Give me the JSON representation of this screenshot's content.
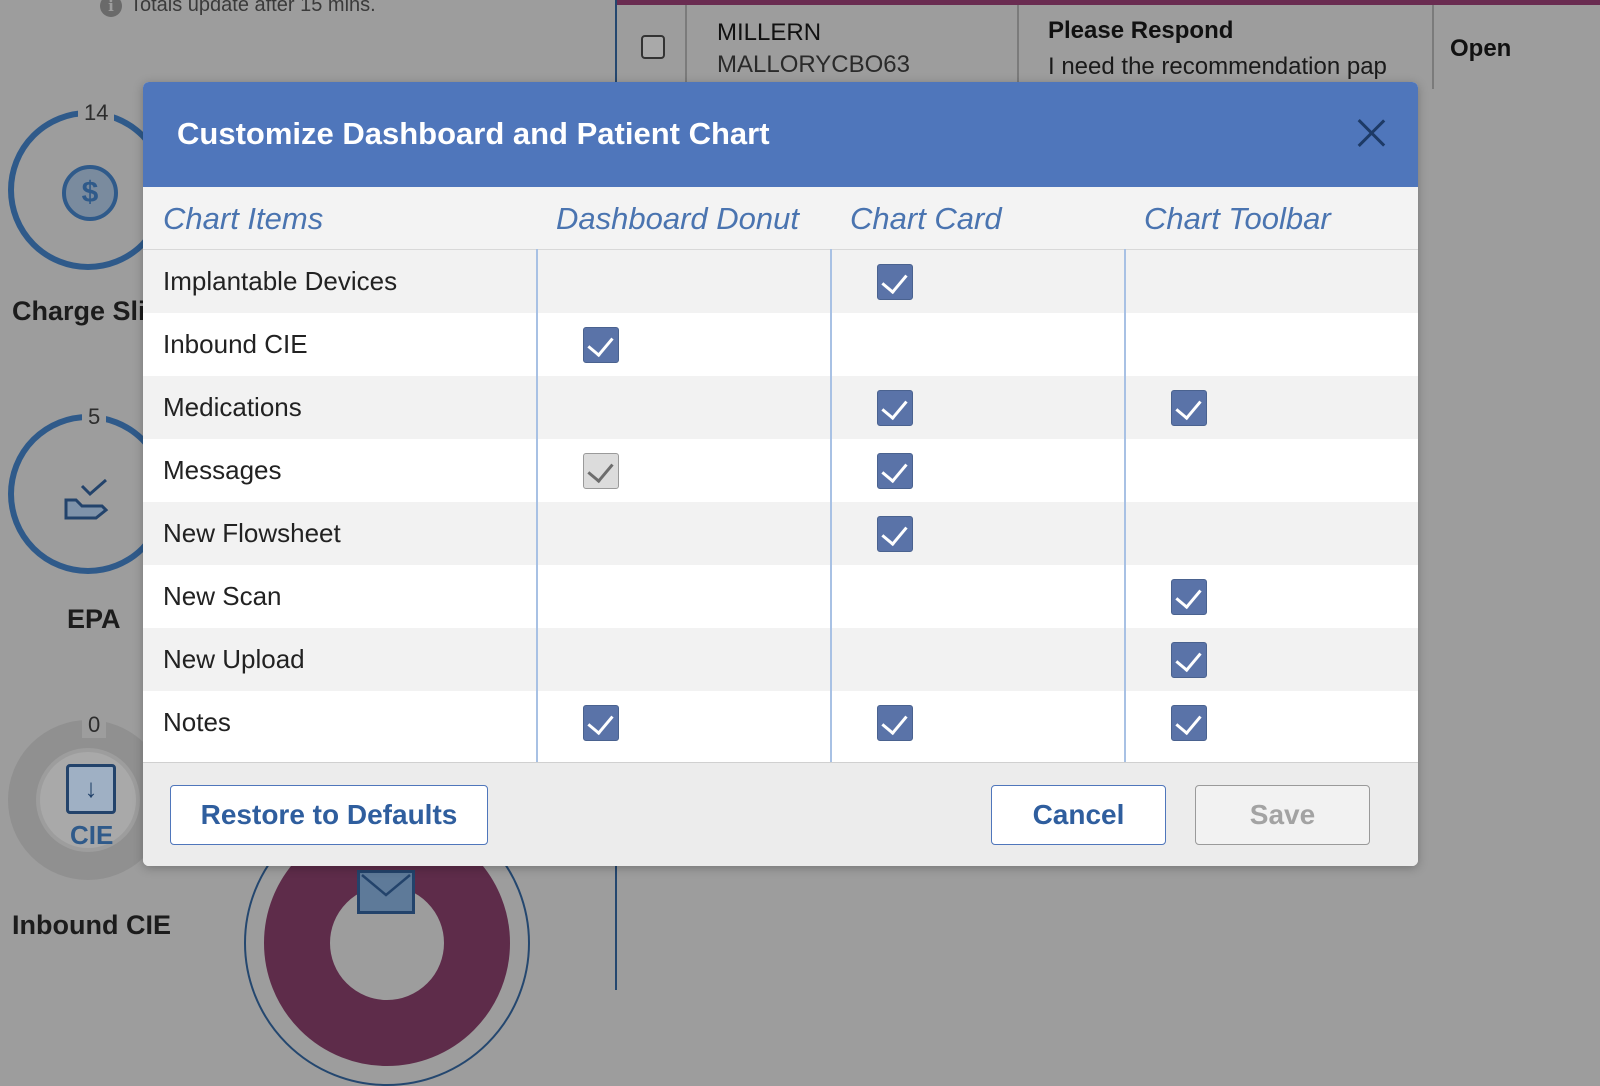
{
  "background": {
    "note": "Totals update after 15 mins.",
    "donuts": [
      {
        "count": "14",
        "label": "Charge Sli"
      },
      {
        "count": "5",
        "label": "EPA"
      },
      {
        "count": "0",
        "label": "Inbound CIE",
        "icon_text": "CIE"
      }
    ],
    "message_row": {
      "name": "MILLERN",
      "username": "MALLORYCBO63",
      "subject": "Please Respond",
      "body": "I need the recommendation pap",
      "status": "Open"
    }
  },
  "modal": {
    "title": "Customize Dashboard and Patient Chart",
    "columns": [
      "Chart Items",
      "Dashboard Donut",
      "Chart Card",
      "Chart Toolbar"
    ],
    "rows": [
      {
        "label": "Implantable Devices",
        "donut": "none",
        "card": "checked",
        "toolbar": "none"
      },
      {
        "label": "Inbound CIE",
        "donut": "checked",
        "card": "none",
        "toolbar": "none"
      },
      {
        "label": "Medications",
        "donut": "none",
        "card": "checked",
        "toolbar": "checked"
      },
      {
        "label": "Messages",
        "donut": "disabled-checked",
        "card": "checked",
        "toolbar": "none"
      },
      {
        "label": "New Flowsheet",
        "donut": "none",
        "card": "checked",
        "toolbar": "none"
      },
      {
        "label": "New Scan",
        "donut": "none",
        "card": "none",
        "toolbar": "checked"
      },
      {
        "label": "New Upload",
        "donut": "none",
        "card": "none",
        "toolbar": "checked"
      },
      {
        "label": "Notes",
        "donut": "checked",
        "card": "checked",
        "toolbar": "checked"
      }
    ],
    "buttons": {
      "restore": "Restore to Defaults",
      "cancel": "Cancel",
      "save": "Save"
    },
    "colors": {
      "header": "#4f76bb",
      "checkbox": "#5a73a8",
      "column_header_text": "#4a74b0"
    }
  }
}
